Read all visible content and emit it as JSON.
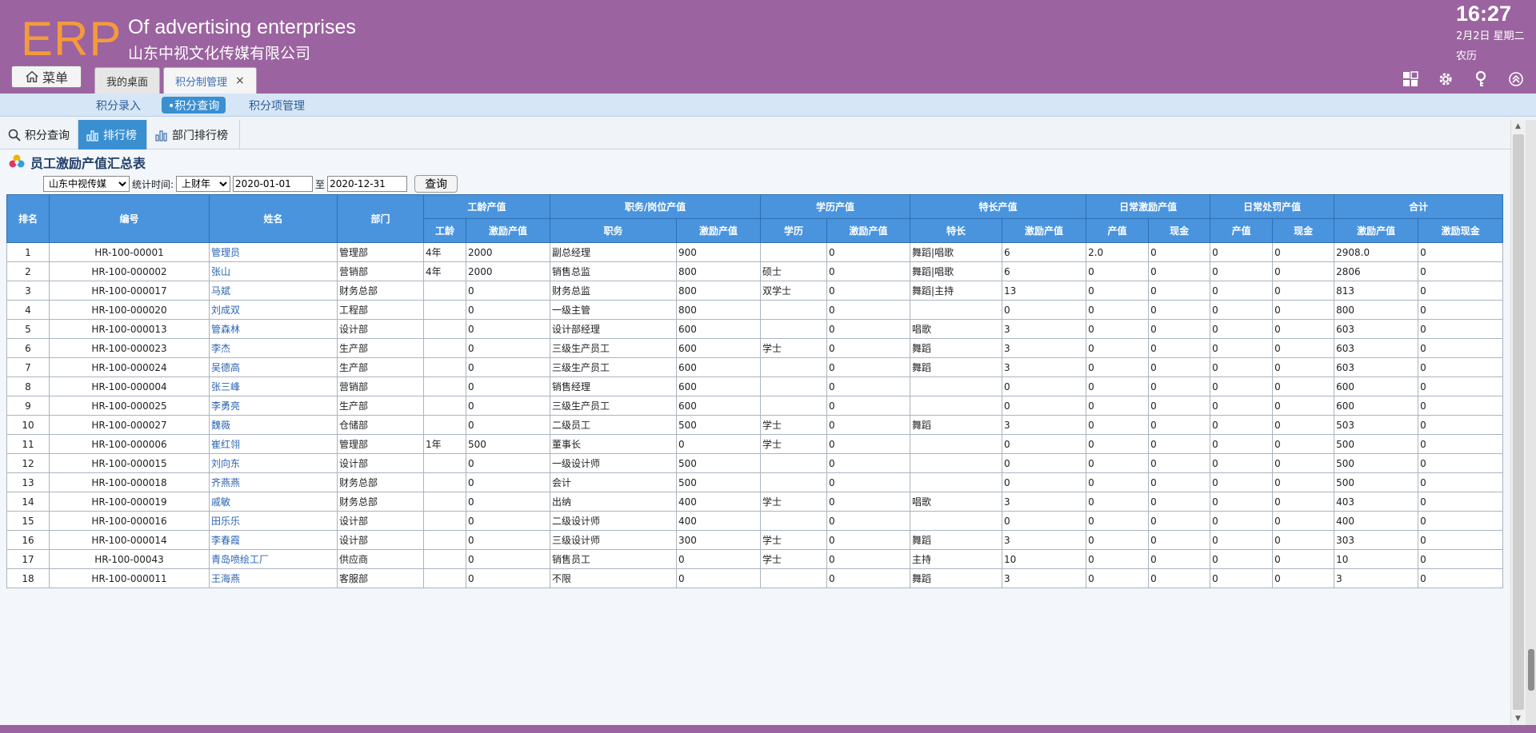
{
  "header": {
    "logo": "ERP",
    "brand_en": "Of advertising enterprises",
    "brand_cn": "山东中视文化传媒有限公司",
    "time": "16:27",
    "date": "2月2日 星期二",
    "lunar": "农历",
    "menu_label": "菜单",
    "tabs": [
      {
        "label": "我的桌面"
      },
      {
        "label": "积分制管理",
        "close": "×"
      }
    ]
  },
  "subnav": {
    "items": [
      "积分录入",
      "•积分查询",
      "积分项管理"
    ]
  },
  "toolbar": {
    "items": [
      "积分查询",
      "排行榜",
      "部门排行榜"
    ]
  },
  "page": {
    "title": "员工激励产值汇总表",
    "company": "山东中视传媒",
    "stat_label": "统计时间:",
    "period": "上财年",
    "start_date": "2020-01-01",
    "to_label": "至",
    "end_date": "2020-12-31",
    "query_label": "查询"
  },
  "table": {
    "groups": {
      "rank": "排名",
      "code": "编号",
      "name": "姓名",
      "dept": "部门",
      "seniority": "工龄产值",
      "position": "职务/岗位产值",
      "education": "学历产值",
      "specialty": "特长产值",
      "daily_incentive": "日常激励产值",
      "daily_penalty": "日常处罚产值",
      "total": "合计"
    },
    "sub": {
      "seniority": "工龄",
      "seniority_value": "激励产值",
      "position": "职务",
      "position_value": "激励产值",
      "education": "学历",
      "education_value": "激励产值",
      "specialty": "特长",
      "specialty_value": "激励产值",
      "di_value": "产值",
      "di_cash": "现金",
      "dp_value": "产值",
      "dp_cash": "现金",
      "total_value": "激励产值",
      "total_cash": "激励现金"
    },
    "rows": [
      [
        "1",
        "HR-100-00001",
        "管理员",
        "管理部",
        "4年",
        "2000",
        "副总经理",
        "900",
        "",
        "0",
        "舞蹈|唱歌",
        "6",
        "2.0",
        "0",
        "0",
        "0",
        "2908.0",
        "0"
      ],
      [
        "2",
        "HR-100-000002",
        "张山",
        "营销部",
        "4年",
        "2000",
        "销售总监",
        "800",
        "硕士",
        "0",
        "舞蹈|唱歌",
        "6",
        "0",
        "0",
        "0",
        "0",
        "2806",
        "0"
      ],
      [
        "3",
        "HR-100-000017",
        "马斌",
        "财务总部",
        "",
        "0",
        "财务总监",
        "800",
        "双学士",
        "0",
        "舞蹈|主持",
        "13",
        "0",
        "0",
        "0",
        "0",
        "813",
        "0"
      ],
      [
        "4",
        "HR-100-000020",
        "刘成双",
        "工程部",
        "",
        "0",
        "一级主管",
        "800",
        "",
        "0",
        "",
        "0",
        "0",
        "0",
        "0",
        "0",
        "800",
        "0"
      ],
      [
        "5",
        "HR-100-000013",
        "管森林",
        "设计部",
        "",
        "0",
        "设计部经理",
        "600",
        "",
        "0",
        "唱歌",
        "3",
        "0",
        "0",
        "0",
        "0",
        "603",
        "0"
      ],
      [
        "6",
        "HR-100-000023",
        "李杰",
        "生产部",
        "",
        "0",
        "三级生产员工",
        "600",
        "学士",
        "0",
        "舞蹈",
        "3",
        "0",
        "0",
        "0",
        "0",
        "603",
        "0"
      ],
      [
        "7",
        "HR-100-000024",
        "吴德高",
        "生产部",
        "",
        "0",
        "三级生产员工",
        "600",
        "",
        "0",
        "舞蹈",
        "3",
        "0",
        "0",
        "0",
        "0",
        "603",
        "0"
      ],
      [
        "8",
        "HR-100-000004",
        "张三峰",
        "营销部",
        "",
        "0",
        "销售经理",
        "600",
        "",
        "0",
        "",
        "0",
        "0",
        "0",
        "0",
        "0",
        "600",
        "0"
      ],
      [
        "9",
        "HR-100-000025",
        "李勇亮",
        "生产部",
        "",
        "0",
        "三级生产员工",
        "600",
        "",
        "0",
        "",
        "0",
        "0",
        "0",
        "0",
        "0",
        "600",
        "0"
      ],
      [
        "10",
        "HR-100-000027",
        "魏薇",
        "仓储部",
        "",
        "0",
        "二级员工",
        "500",
        "学士",
        "0",
        "舞蹈",
        "3",
        "0",
        "0",
        "0",
        "0",
        "503",
        "0"
      ],
      [
        "11",
        "HR-100-000006",
        "崔红翎",
        "管理部",
        "1年",
        "500",
        "董事长",
        "0",
        "学士",
        "0",
        "",
        "0",
        "0",
        "0",
        "0",
        "0",
        "500",
        "0"
      ],
      [
        "12",
        "HR-100-000015",
        "刘向东",
        "设计部",
        "",
        "0",
        "一级设计师",
        "500",
        "",
        "0",
        "",
        "0",
        "0",
        "0",
        "0",
        "0",
        "500",
        "0"
      ],
      [
        "13",
        "HR-100-000018",
        "齐燕燕",
        "财务总部",
        "",
        "0",
        "会计",
        "500",
        "",
        "0",
        "",
        "0",
        "0",
        "0",
        "0",
        "0",
        "500",
        "0"
      ],
      [
        "14",
        "HR-100-000019",
        "戚敏",
        "财务总部",
        "",
        "0",
        "出纳",
        "400",
        "学士",
        "0",
        "唱歌",
        "3",
        "0",
        "0",
        "0",
        "0",
        "403",
        "0"
      ],
      [
        "15",
        "HR-100-000016",
        "田乐乐",
        "设计部",
        "",
        "0",
        "二级设计师",
        "400",
        "",
        "0",
        "",
        "0",
        "0",
        "0",
        "0",
        "0",
        "400",
        "0"
      ],
      [
        "16",
        "HR-100-000014",
        "李春霞",
        "设计部",
        "",
        "0",
        "三级设计师",
        "300",
        "学士",
        "0",
        "舞蹈",
        "3",
        "0",
        "0",
        "0",
        "0",
        "303",
        "0"
      ],
      [
        "17",
        "HR-100-00043",
        "青岛喷绘工厂",
        "供应商",
        "",
        "0",
        "销售员工",
        "0",
        "学士",
        "0",
        "主持",
        "10",
        "0",
        "0",
        "0",
        "0",
        "10",
        "0"
      ],
      [
        "18",
        "HR-100-000011",
        "王海燕",
        "客服部",
        "",
        "0",
        "不限",
        "0",
        "",
        "0",
        "舞蹈",
        "3",
        "0",
        "0",
        "0",
        "0",
        "3",
        "0"
      ]
    ]
  }
}
